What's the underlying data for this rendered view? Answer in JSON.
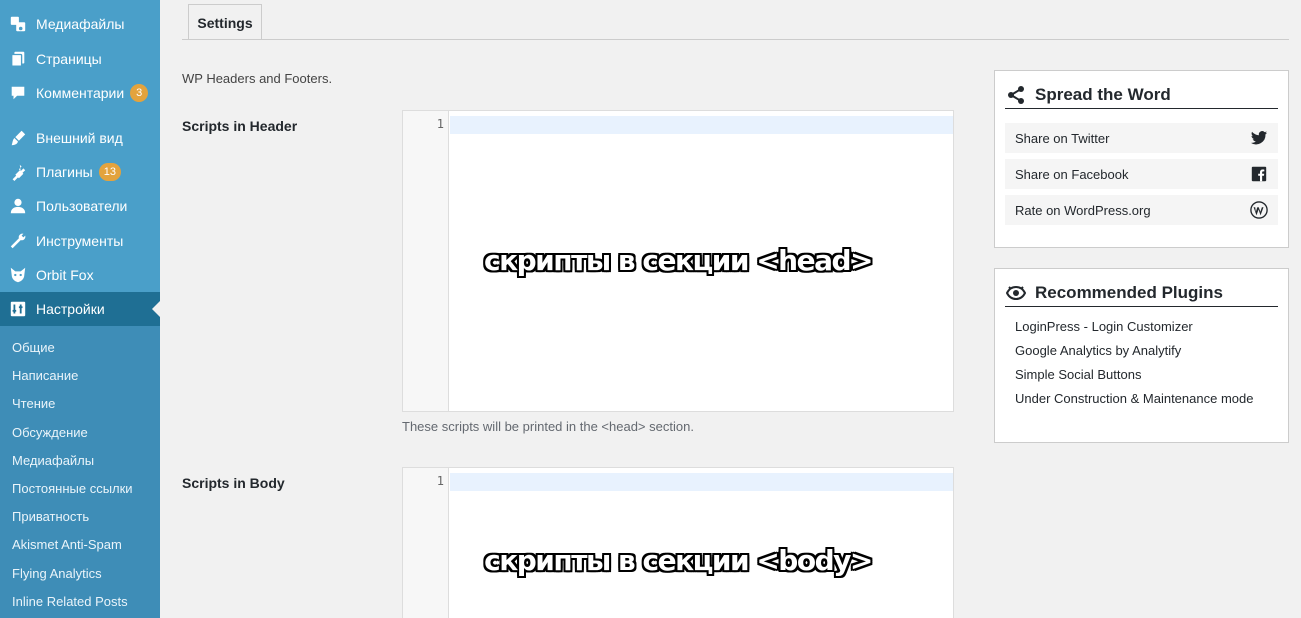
{
  "sidebar": {
    "menu": [
      {
        "label": "Медиафайлы",
        "icon": "media-icon"
      },
      {
        "label": "Страницы",
        "icon": "pages-icon"
      },
      {
        "label": "Комментарии",
        "icon": "comments-icon",
        "badge": "3"
      },
      {
        "label": "Внешний вид",
        "icon": "appearance-icon"
      },
      {
        "label": "Плагины",
        "icon": "plugins-icon",
        "badge": "13"
      },
      {
        "label": "Пользователи",
        "icon": "users-icon"
      },
      {
        "label": "Инструменты",
        "icon": "tools-icon"
      },
      {
        "label": "Orbit Fox",
        "icon": "fox-icon"
      },
      {
        "label": "Настройки",
        "icon": "settings-icon"
      }
    ],
    "submenu": [
      "Общие",
      "Написание",
      "Чтение",
      "Обсуждение",
      "Медиафайлы",
      "Постоянные ссылки",
      "Приватность",
      "Akismet Anti-Spam",
      "Flying Analytics",
      "Inline Related Posts"
    ]
  },
  "main": {
    "tab_label": "Settings",
    "intro": "WP Headers and Footers.",
    "header_section": {
      "label": "Scripts in Header",
      "line_number": "1",
      "overlay": "скрипты в секции <head>",
      "help": "These scripts will be printed in the <head> section."
    },
    "body_section": {
      "label": "Scripts in Body",
      "line_number": "1",
      "overlay": "скрипты в секции <body>"
    }
  },
  "widgets": {
    "spread": {
      "title": "Spread the Word",
      "items": [
        {
          "label": "Share on Twitter",
          "icon": "twitter-icon"
        },
        {
          "label": "Share on Facebook",
          "icon": "facebook-icon"
        },
        {
          "label": "Rate on WordPress.org",
          "icon": "wordpress-icon"
        }
      ]
    },
    "recommended": {
      "title": "Recommended Plugins",
      "items": [
        "LoginPress - Login Customizer",
        "Google Analytics by Analytify",
        "Simple Social Buttons",
        "Under Construction & Maintenance mode"
      ]
    }
  },
  "colors": {
    "sidebar": "#4a9fc9",
    "sidebar_current": "#1f6f94",
    "submenu": "#3e8db7",
    "badge": "#e3a33d"
  }
}
